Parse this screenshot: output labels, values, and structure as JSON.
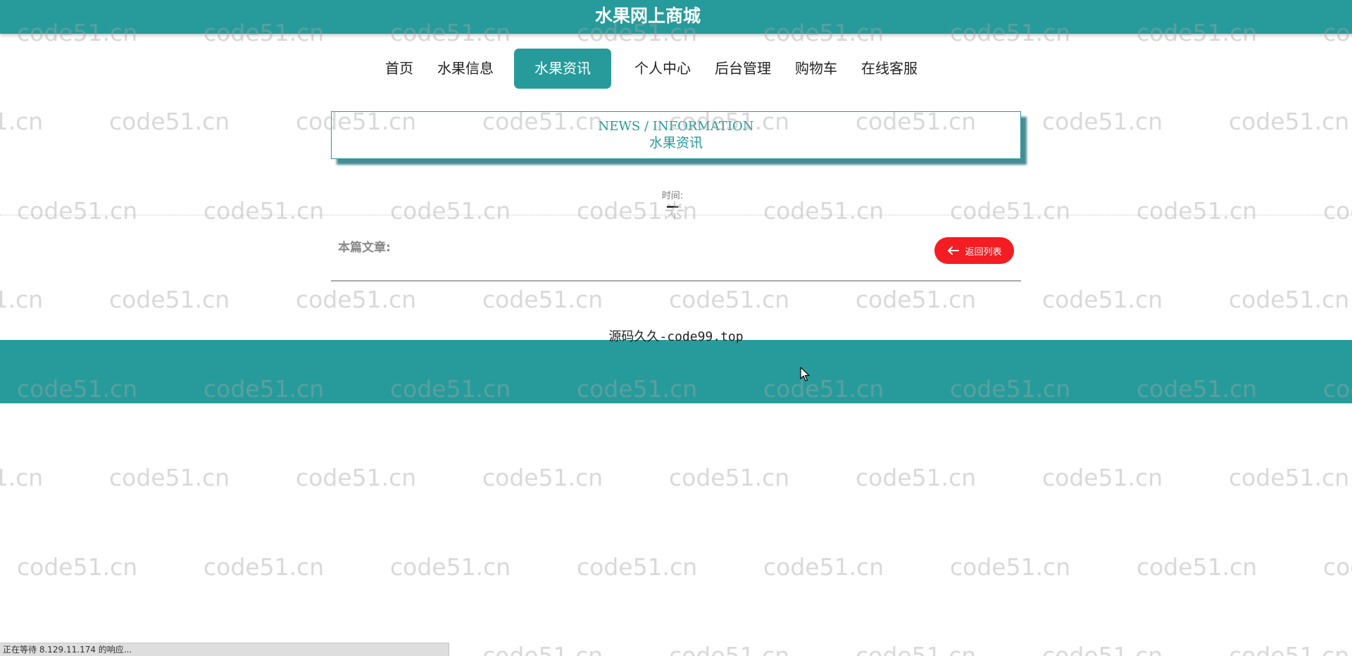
{
  "header": {
    "site_title": "水果网上商城"
  },
  "nav": {
    "items": [
      {
        "label": "首页",
        "active": false
      },
      {
        "label": "水果信息",
        "active": false
      },
      {
        "label": "水果资讯",
        "active": true
      },
      {
        "label": "个人中心",
        "active": false
      },
      {
        "label": "后台管理",
        "active": false
      },
      {
        "label": "购物车",
        "active": false
      },
      {
        "label": "在线客服",
        "active": false
      }
    ]
  },
  "news_box": {
    "title_en": "NEWS / INFORMATION",
    "title_cn": "水果资讯"
  },
  "article": {
    "time_label": "时间:",
    "time_value": "—",
    "article_label": "本篇文章:",
    "back_button_label": "返回列表"
  },
  "footer": {
    "source_text": "源码久久-code99.top"
  },
  "watermark": {
    "text": "code51.cn"
  },
  "status_bar": {
    "text": "正在等待 8.129.11.174 的响应..."
  },
  "colors": {
    "primary": "#279b9b",
    "danger": "#f31d23",
    "text_gray": "#888888"
  },
  "icons": {
    "back_arrow": "arrow-left-icon",
    "loading": "spinner-icon",
    "cursor": "mouse-pointer-icon"
  }
}
